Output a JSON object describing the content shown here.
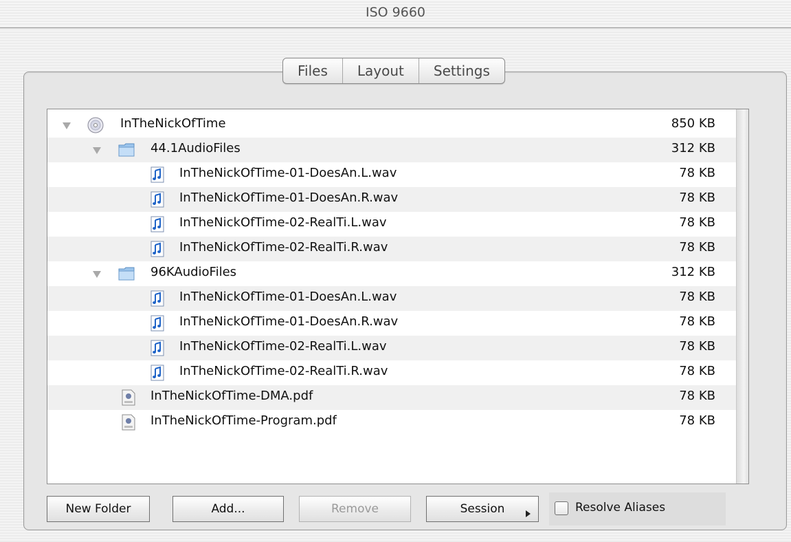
{
  "window": {
    "title": "ISO 9660"
  },
  "tabs": [
    {
      "label": "Files"
    },
    {
      "label": "Layout"
    },
    {
      "label": "Settings"
    }
  ],
  "file_list": {
    "rows": [
      {
        "name": "InTheNickOfTime",
        "size": "850 KB",
        "kind": "disc",
        "level": 0,
        "expanded": true
      },
      {
        "name": "44.1AudioFiles",
        "size": "312 KB",
        "kind": "folder",
        "level": 1,
        "expanded": true
      },
      {
        "name": "InTheNickOfTime-01-DoesAn.L.wav",
        "size": "78 KB",
        "kind": "audio",
        "level": 2
      },
      {
        "name": "InTheNickOfTime-01-DoesAn.R.wav",
        "size": "78 KB",
        "kind": "audio",
        "level": 2
      },
      {
        "name": "InTheNickOfTime-02-RealTi.L.wav",
        "size": "78 KB",
        "kind": "audio",
        "level": 2
      },
      {
        "name": "InTheNickOfTime-02-RealTi.R.wav",
        "size": "78 KB",
        "kind": "audio",
        "level": 2
      },
      {
        "name": "96KAudioFiles",
        "size": "312 KB",
        "kind": "folder",
        "level": 1,
        "expanded": true
      },
      {
        "name": "InTheNickOfTime-01-DoesAn.L.wav",
        "size": "78 KB",
        "kind": "audio",
        "level": 2
      },
      {
        "name": "InTheNickOfTime-01-DoesAn.R.wav",
        "size": "78 KB",
        "kind": "audio",
        "level": 2
      },
      {
        "name": "InTheNickOfTime-02-RealTi.L.wav",
        "size": "78 KB",
        "kind": "audio",
        "level": 2
      },
      {
        "name": "InTheNickOfTime-02-RealTi.R.wav",
        "size": "78 KB",
        "kind": "audio",
        "level": 2
      },
      {
        "name": "InTheNickOfTime-DMA.pdf",
        "size": "78 KB",
        "kind": "pdf",
        "level": 1
      },
      {
        "name": "InTheNickOfTime-Program.pdf",
        "size": "78 KB",
        "kind": "pdf",
        "level": 1
      }
    ]
  },
  "buttons": {
    "new_folder": "New Folder",
    "add": "Add...",
    "remove": "Remove",
    "session": "Session"
  },
  "resolve_aliases": {
    "label": "Resolve Aliases",
    "checked": false
  },
  "icons": {
    "disc": "disc-icon",
    "folder": "folder-icon",
    "audio": "audio-file-icon",
    "pdf": "pdf-file-icon"
  }
}
